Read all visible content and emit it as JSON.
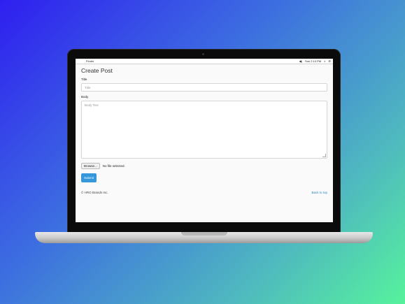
{
  "menubar": {
    "app_name": "Finder",
    "time": "Sun 2:14 PM",
    "apple_icon": "apple-icon"
  },
  "form": {
    "page_title": "Create Post",
    "title_label": "Title",
    "title_placeholder": "Title",
    "body_label": "Body",
    "body_placeholder": "Body Text",
    "browse_label": "Browse...",
    "file_status": "No file selected.",
    "submit_label": "Submit"
  },
  "footer": {
    "copyright": "© HRO Brands Inc.",
    "back_to_top": "Back to top"
  },
  "colors": {
    "accent": "#3498db",
    "link": "#2e86c1"
  }
}
